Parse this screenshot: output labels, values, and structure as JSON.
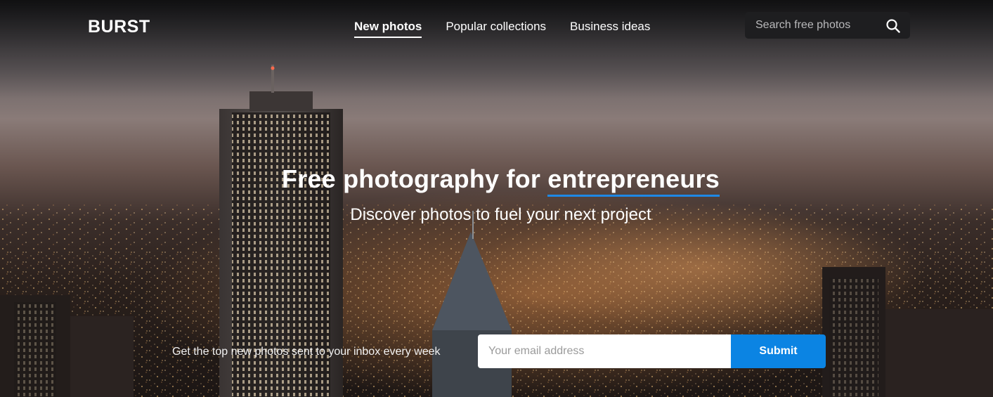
{
  "brand": {
    "logo": "BURST"
  },
  "nav": {
    "items": [
      {
        "label": "New photos",
        "active": true
      },
      {
        "label": "Popular collections",
        "active": false
      },
      {
        "label": "Business ideas",
        "active": false
      }
    ]
  },
  "search": {
    "placeholder": "Search free photos",
    "icon": "search-icon"
  },
  "hero": {
    "headline_prefix": "Free photography for ",
    "headline_accent": "entrepreneurs",
    "subheadline": "Discover photos to fuel your next project",
    "background": "night city skyline with illuminated streets"
  },
  "newsletter": {
    "label": "Get the top new photos sent to your inbox every week",
    "email_placeholder": "Your email address",
    "submit_label": "Submit"
  },
  "colors": {
    "accent": "#0b84e3",
    "underline": "#1e88e5",
    "search_bg": "#1e1e20"
  }
}
